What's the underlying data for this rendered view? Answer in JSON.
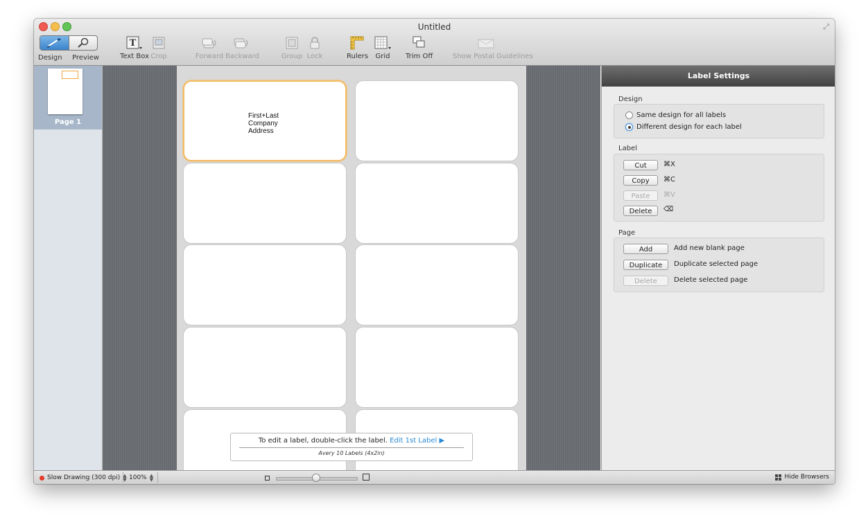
{
  "window": {
    "title": "Untitled"
  },
  "toolbar": {
    "mode_design": "Design",
    "mode_preview": "Preview",
    "text_box": "Text Box",
    "crop": "Crop",
    "forward": "Forward",
    "backward": "Backward",
    "group": "Group",
    "lock": "Lock",
    "rulers": "Rulers",
    "grid": "Grid",
    "trim_off": "Trim Off",
    "postal": "Show Postal Guidelines"
  },
  "sidebar": {
    "page_label": "Page 1"
  },
  "canvas": {
    "first_label_lines": [
      "First+Last",
      "Company",
      "Address"
    ],
    "hint": {
      "text": "To edit a label, double-click the label.",
      "link": "Edit 1st Label ▶",
      "template": "Avery 10 Labels (4x2in)"
    }
  },
  "panel": {
    "title": "Label Settings",
    "design": {
      "heading": "Design",
      "option_same": "Same design for all labels",
      "option_different": "Different design for each label",
      "selected": "different"
    },
    "label": {
      "heading": "Label",
      "cut": "Cut",
      "cut_shortcut": "⌘X",
      "copy": "Copy",
      "copy_shortcut": "⌘C",
      "paste": "Paste",
      "paste_shortcut": "⌘V",
      "delete": "Delete",
      "delete_shortcut": "⌫"
    },
    "page": {
      "heading": "Page",
      "add": "Add",
      "add_desc": "Add new blank page",
      "duplicate": "Duplicate",
      "duplicate_desc": "Duplicate selected page",
      "delete": "Delete",
      "delete_desc": "Delete selected page"
    }
  },
  "status": {
    "drawing": "Slow Drawing (300 dpi)",
    "zoom": "100%",
    "hide_browsers": "Hide Browsers"
  }
}
